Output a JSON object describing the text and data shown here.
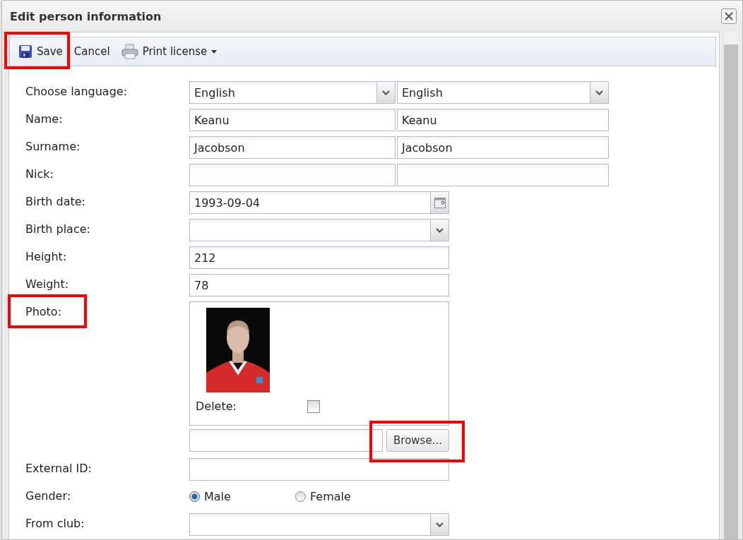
{
  "window": {
    "title": "Edit person information"
  },
  "toolbar": [
    {
      "kind": "save",
      "label": "Save",
      "highlighted": true
    },
    {
      "kind": "cancel",
      "label": "Cancel",
      "highlighted": false
    },
    {
      "kind": "print_menu",
      "label": "Print license",
      "highlighted": false
    }
  ],
  "form": [
    {
      "kind": "select_pair",
      "label": "Choose language:",
      "values": [
        "English",
        "English"
      ]
    },
    {
      "kind": "text_pair",
      "label": "Name:",
      "values": [
        "Keanu",
        "Keanu"
      ]
    },
    {
      "kind": "text_pair",
      "label": "Surname:",
      "values": [
        "Jacobson",
        "Jacobson"
      ]
    },
    {
      "kind": "text_pair",
      "label": "Nick:"
    },
    {
      "kind": "date",
      "label": "Birth date:",
      "value": "1993-09-04"
    },
    {
      "kind": "select",
      "label": "Birth place:"
    },
    {
      "kind": "text",
      "label": "Height:",
      "value": "212"
    },
    {
      "kind": "text",
      "label": "Weight:",
      "value": "78"
    },
    {
      "label": "Photo:",
      "highlighted": true,
      "delete": {
        "label": "Delete:",
        "checked": false
      }
    },
    {
      "kind": "file",
      "button": "Browse...",
      "highlighted": true
    },
    {
      "kind": "text",
      "label": "External ID:"
    },
    {
      "kind": "radio",
      "label": "Gender:",
      "options": [
        {
          "label": "Male",
          "selected": true
        },
        {
          "label": "Female",
          "selected": false
        }
      ]
    },
    {
      "kind": "select",
      "label": "From club:"
    }
  ]
}
